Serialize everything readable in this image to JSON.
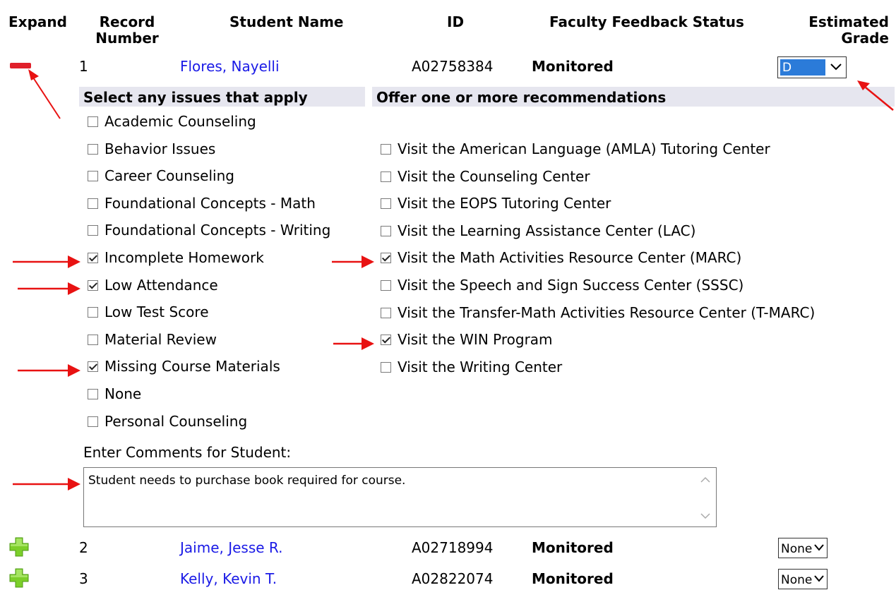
{
  "headers": {
    "expand": "Expand",
    "record_number_line1": "Record",
    "record_number_line2": "Number",
    "student_name": "Student Name",
    "id": "ID",
    "faculty_feedback_status": "Faculty Feedback Status",
    "estimated_grade_line1": "Estimated",
    "estimated_grade_line2": "Grade"
  },
  "students": [
    {
      "record": "1",
      "name": "Flores, Nayelli",
      "id": "A02758384",
      "status": "Monitored",
      "grade": "D",
      "expanded": true,
      "expand_icon": "minus-icon"
    },
    {
      "record": "2",
      "name": "Jaime, Jesse R.",
      "id": "A02718994",
      "status": "Monitored",
      "grade": "None",
      "expanded": false,
      "expand_icon": "plus-icon"
    },
    {
      "record": "3",
      "name": "Kelly, Kevin T.",
      "id": "A02822074",
      "status": "Monitored",
      "grade": "None",
      "expanded": false,
      "expand_icon": "plus-icon"
    }
  ],
  "issues": {
    "header": "Select any issues that apply",
    "items": [
      {
        "label": "Academic Counseling",
        "checked": false
      },
      {
        "label": "Behavior Issues",
        "checked": false
      },
      {
        "label": "Career Counseling",
        "checked": false
      },
      {
        "label": "Foundational Concepts - Math",
        "checked": false
      },
      {
        "label": "Foundational Concepts - Writing",
        "checked": false
      },
      {
        "label": "Incomplete Homework",
        "checked": true
      },
      {
        "label": "Low Attendance",
        "checked": true
      },
      {
        "label": "Low Test Score",
        "checked": false
      },
      {
        "label": "Material Review",
        "checked": false
      },
      {
        "label": "Missing Course Materials",
        "checked": true
      },
      {
        "label": "None",
        "checked": false
      },
      {
        "label": "Personal Counseling",
        "checked": false
      }
    ]
  },
  "recommendations": {
    "header": "Offer one or more recommendations",
    "items": [
      {
        "label": "Visit the American Language (AMLA) Tutoring Center",
        "checked": false
      },
      {
        "label": "Visit the Counseling Center",
        "checked": false
      },
      {
        "label": "Visit the EOPS Tutoring Center",
        "checked": false
      },
      {
        "label": "Visit the Learning Assistance Center (LAC)",
        "checked": false
      },
      {
        "label": "Visit the Math Activities Resource Center (MARC)",
        "checked": true
      },
      {
        "label": "Visit the Speech and Sign Success Center (SSSC)",
        "checked": false
      },
      {
        "label": "Visit the Transfer-Math Activities Resource Center (T-MARC)",
        "checked": false
      },
      {
        "label": "Visit the WIN Program",
        "checked": true
      },
      {
        "label": "Visit the Writing Center",
        "checked": false
      }
    ]
  },
  "comments": {
    "label": "Enter Comments for Student:",
    "value": "Student needs to purchase book required for course."
  },
  "colors": {
    "link": "#1a1ae6",
    "annotation_arrow": "#e81212",
    "expand_minus": "#e0202a",
    "expand_plus": "#7ccf2a",
    "grade_selected_bg": "#2b7bd9",
    "section_header_bg": "#e6e6ef"
  }
}
